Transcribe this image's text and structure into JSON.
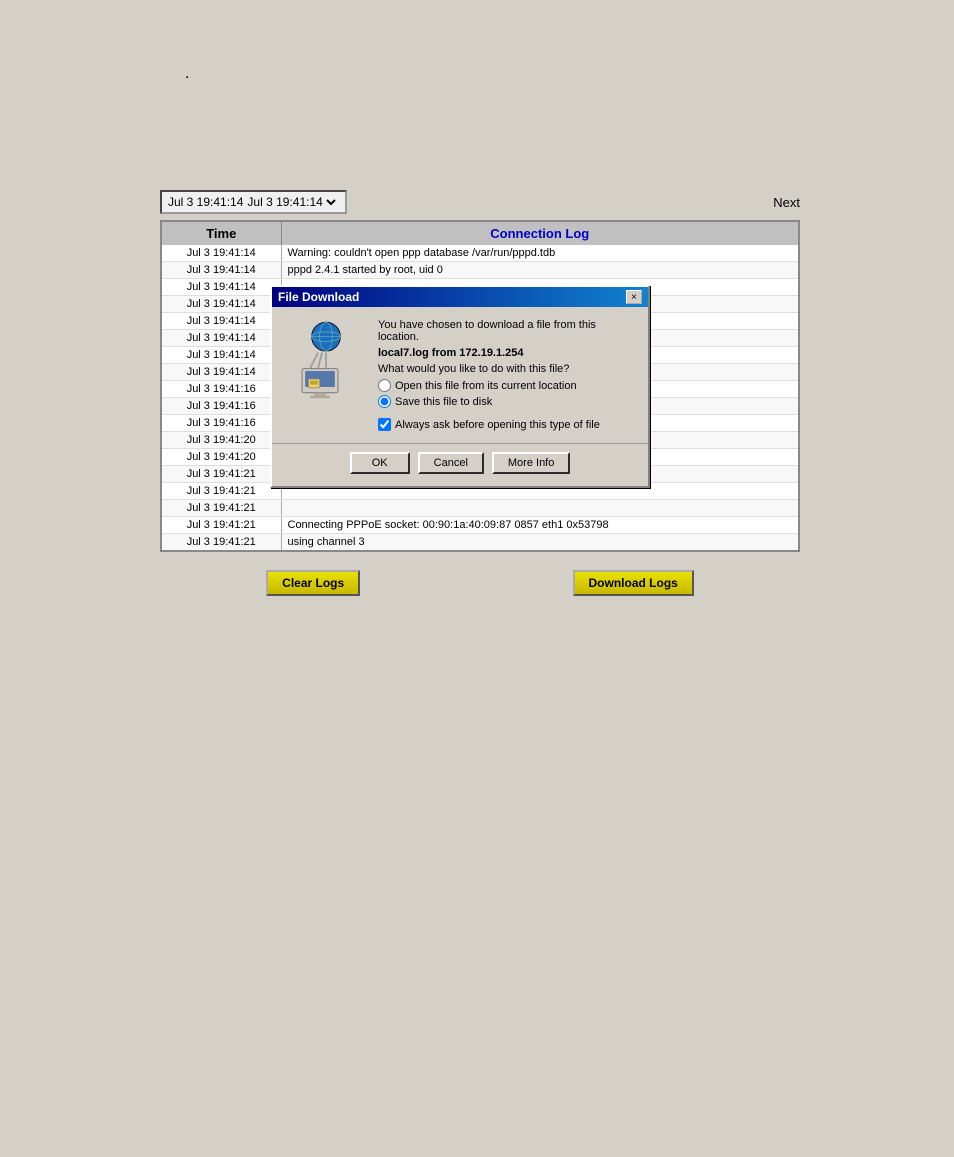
{
  "dot": ".",
  "top_bar": {
    "date_label": "Jul 3 19:41:14",
    "next_label": "Next"
  },
  "table": {
    "headers": {
      "time": "Time",
      "conn_log": "Connection Log"
    },
    "rows": [
      {
        "time": "Jul 3 19:41:14",
        "msg": "Warning: couldn't open ppp database /var/run/pppd.tdb"
      },
      {
        "time": "Jul 3 19:41:14",
        "msg": "pppd 2.4.1 started by root, uid 0"
      },
      {
        "time": "Jul 3 19:41:14",
        "msg": ""
      },
      {
        "time": "Jul 3 19:41:14",
        "msg": ""
      },
      {
        "time": "Jul 3 19:41:14",
        "msg": ""
      },
      {
        "time": "Jul 3 19:41:14",
        "msg": ""
      },
      {
        "time": "Jul 3 19:41:14",
        "msg": ""
      },
      {
        "time": "Jul 3 19:41:14",
        "msg": ""
      },
      {
        "time": "Jul 3 19:41:16",
        "msg": ""
      },
      {
        "time": "Jul 3 19:41:16",
        "msg": ""
      },
      {
        "time": "Jul 3 19:41:16",
        "msg": ""
      },
      {
        "time": "Jul 3 19:41:20",
        "msg": ""
      },
      {
        "time": "Jul 3 19:41:20",
        "msg": ""
      },
      {
        "time": "Jul 3 19:41:21",
        "msg": ""
      },
      {
        "time": "Jul 3 19:41:21",
        "msg": ""
      },
      {
        "time": "Jul 3 19:41:21",
        "msg": ""
      },
      {
        "time": "Jul 3 19:41:21",
        "msg": "Connecting PPPoE socket: 00:90:1a:40:09:87 0857 eth1 0x53798"
      },
      {
        "time": "Jul 3 19:41:21",
        "msg": "using channel 3"
      }
    ]
  },
  "buttons": {
    "clear_logs": "Clear Logs",
    "download_logs": "Download Logs"
  },
  "dialog": {
    "title": "File Download",
    "close_label": "×",
    "message": "You have chosen to download a file from this location.",
    "filename": "local7.log from 172.19.1.254",
    "question": "What would you like to do with this file?",
    "radio_open": "Open this file from its current location",
    "radio_save": "Save this file to disk",
    "checkbox_label": "Always ask before opening this type of file",
    "btn_ok": "OK",
    "btn_cancel": "Cancel",
    "btn_more": "More Info"
  }
}
